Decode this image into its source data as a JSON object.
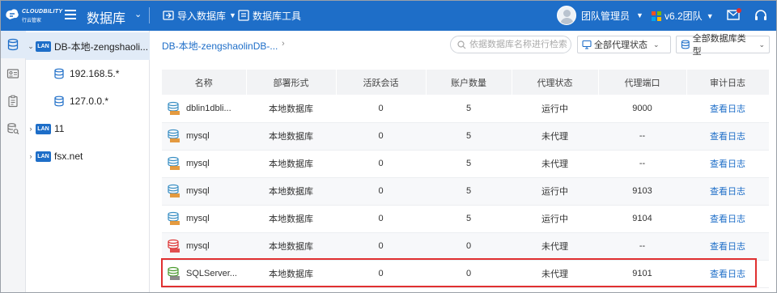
{
  "header": {
    "logo_brand": "CLOUDBILITY",
    "logo_sub": "行云管家",
    "app_title": "数据库",
    "import_label": "导入数据库",
    "tools_label": "数据库工具",
    "user_name": "团队管理员",
    "version_label": "v6.2团队",
    "colors": {
      "bar": "#1e6ec8"
    }
  },
  "tree": {
    "nodes": [
      {
        "tag": "LAN",
        "label": "DB-本地-zengshaoli..."
      },
      {
        "label": "192.168.5.*"
      },
      {
        "label": "127.0.0.*"
      },
      {
        "tag": "LAN",
        "label": "11"
      },
      {
        "tag": "LAN",
        "label": "fsx.net"
      }
    ]
  },
  "main": {
    "breadcrumb": "DB-本地-zengshaolinDB-...",
    "search_placeholder": "依据数据库名称进行检索",
    "agent_filter": "全部代理状态",
    "dbtype_filter": "全部数据库类型",
    "columns": [
      "名称",
      "部署形式",
      "活跃会话",
      "账户数量",
      "代理状态",
      "代理端口",
      "审计日志"
    ],
    "rows": [
      {
        "name": "dblin1dbli...",
        "deploy": "本地数据库",
        "sessions": "0",
        "accounts": "5",
        "status": "运行中",
        "status_kind": "running",
        "port": "9000",
        "log": "查看日志",
        "icon": "mysql"
      },
      {
        "name": "mysql",
        "deploy": "本地数据库",
        "sessions": "0",
        "accounts": "5",
        "status": "未代理",
        "status_kind": "idle",
        "port": "--",
        "log": "查看日志",
        "icon": "mysql"
      },
      {
        "name": "mysql",
        "deploy": "本地数据库",
        "sessions": "0",
        "accounts": "5",
        "status": "未代理",
        "status_kind": "idle",
        "port": "--",
        "log": "查看日志",
        "icon": "mysql"
      },
      {
        "name": "mysql",
        "deploy": "本地数据库",
        "sessions": "0",
        "accounts": "5",
        "status": "运行中",
        "status_kind": "running",
        "port": "9103",
        "log": "查看日志",
        "icon": "mysql"
      },
      {
        "name": "mysql",
        "deploy": "本地数据库",
        "sessions": "0",
        "accounts": "5",
        "status": "运行中",
        "status_kind": "running",
        "port": "9104",
        "log": "查看日志",
        "icon": "mysql"
      },
      {
        "name": "mysql",
        "deploy": "本地数据库",
        "sessions": "0",
        "accounts": "0",
        "status": "未代理",
        "status_kind": "idle",
        "port": "--",
        "log": "查看日志",
        "icon": "oracle"
      },
      {
        "name": "SQLServer...",
        "deploy": "本地数据库",
        "sessions": "0",
        "accounts": "0",
        "status": "未代理",
        "status_kind": "idle",
        "port": "9101",
        "log": "查看日志",
        "icon": "sqlserver"
      }
    ]
  }
}
